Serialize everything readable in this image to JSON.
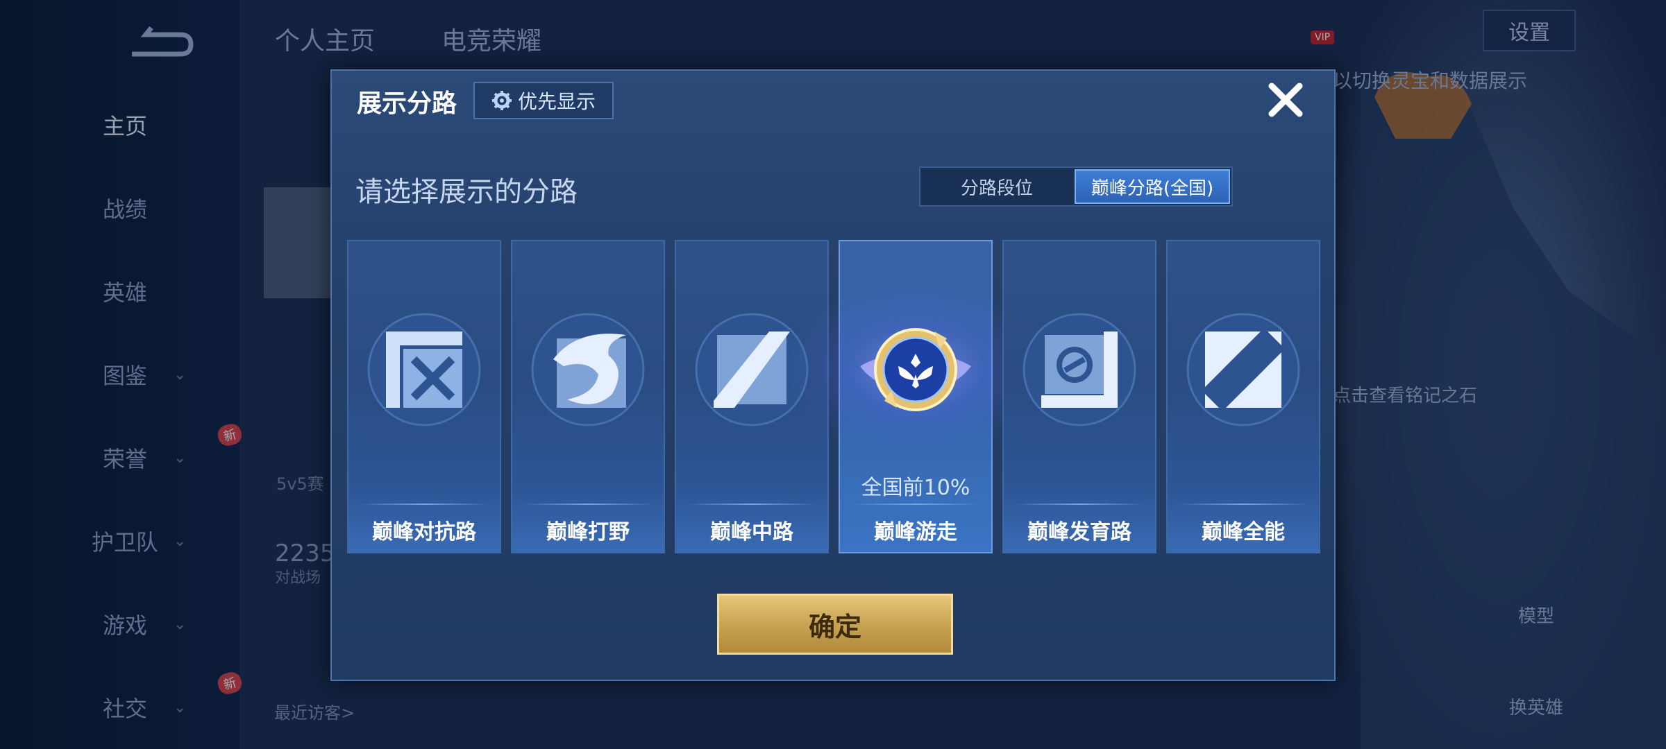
{
  "nav": {
    "items": [
      {
        "label": "主页",
        "active": true
      },
      {
        "label": "战绩"
      },
      {
        "label": "英雄"
      },
      {
        "label": "图鉴"
      },
      {
        "label": "荣誉"
      },
      {
        "label": "护卫队"
      },
      {
        "label": "游戏"
      },
      {
        "label": "社交"
      }
    ],
    "new_badge": "新"
  },
  "top_tabs": [
    "个人主页",
    "电竞荣耀"
  ],
  "top_right": {
    "settings_label": "设置",
    "vip_label": "VIP"
  },
  "background": {
    "hint_switch": "以切换灵宝和数据展示",
    "hint_inscription": "点击查看铭记之石",
    "stat_number": "2235",
    "stat_sub": "对战场",
    "mode_label": "5v5赛",
    "visitors_label": "最近访客>",
    "model_label": "模型",
    "change_hero_label": "换英雄"
  },
  "modal": {
    "title": "展示分路",
    "priority_label": "优先显示",
    "prompt": "请选择展示的分路",
    "segments": [
      {
        "label": "分路段位",
        "selected": false
      },
      {
        "label": "巅峰分路(全国)",
        "selected": true
      }
    ],
    "cards": [
      {
        "label": "巅峰对抗路",
        "icon": "clash-lane-icon"
      },
      {
        "label": "巅峰打野",
        "icon": "jungle-dragon-icon"
      },
      {
        "label": "巅峰中路",
        "icon": "mid-lane-icon"
      },
      {
        "label": "巅峰游走",
        "icon": "roaming-winged-badge-icon",
        "rank": "全国前10%",
        "selected": true
      },
      {
        "label": "巅峰发育路",
        "icon": "farm-lane-icon"
      },
      {
        "label": "巅峰全能",
        "icon": "all-round-icon"
      }
    ],
    "confirm_label": "确定"
  }
}
